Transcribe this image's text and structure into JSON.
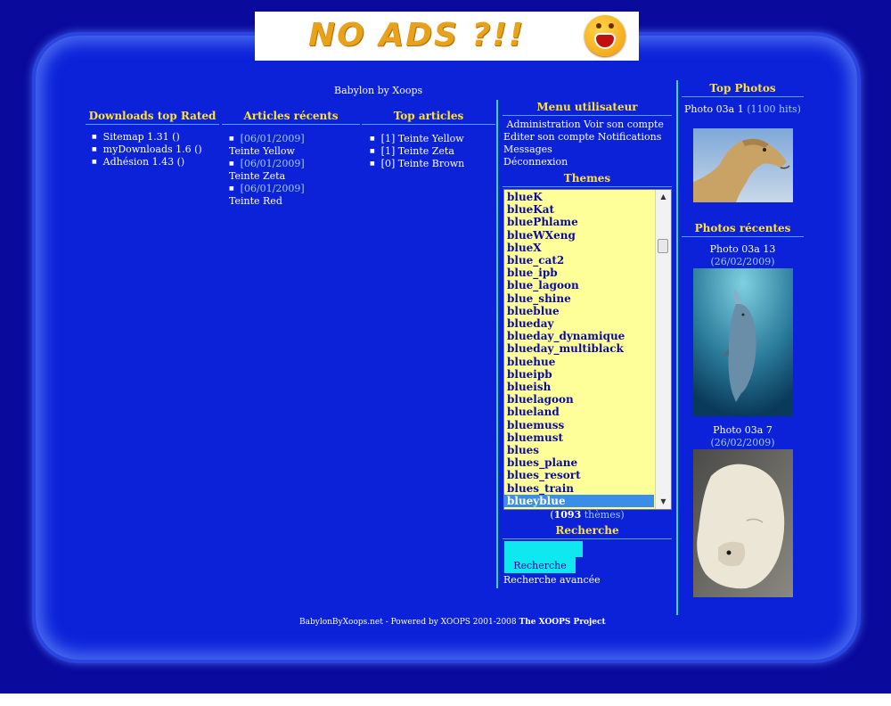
{
  "banner": {
    "text": "NO ADS ?!!"
  },
  "site_title": "Babylon by Xoops",
  "downloads": {
    "title": "Downloads top Rated",
    "items": [
      "Sitemap 1.31 ()",
      "myDownloads 1.6 ()",
      "Adhésion 1.43 ()"
    ]
  },
  "articles_recent": {
    "title": "Articles récents",
    "items": [
      {
        "date": "[06/01/2009]",
        "label": "Teinte Yellow"
      },
      {
        "date": "[06/01/2009]",
        "label": "Teinte Zeta"
      },
      {
        "date": "[06/01/2009]",
        "label": "Teinte Red"
      }
    ]
  },
  "top_articles": {
    "title": "Top articles",
    "items": [
      "[1] Teinte Yellow",
      "[1] Teinte Zeta",
      "[0] Teinte Brown"
    ]
  },
  "user_menu": {
    "title": "Menu utilisateur",
    "items": [
      "Administration",
      "Voir son compte",
      "Editer son compte",
      "Notifications",
      "Messages",
      "Déconnexion"
    ]
  },
  "themes": {
    "title": "Themes",
    "items": [
      "blueK",
      "blueKat",
      "bluePhlame",
      "blueWXeng",
      "blueX",
      "blue_cat2",
      "blue_ipb",
      "blue_lagoon",
      "blue_shine",
      "blueblue",
      "blueday",
      "blueday_dynamique",
      "blueday_multiblack",
      "bluehue",
      "blueipb",
      "blueish",
      "bluelagoon",
      "blueland",
      "bluemuss",
      "bluemust",
      "blues",
      "blues_plane",
      "blues_resort",
      "blues_train",
      "blueyblue"
    ],
    "selected": "blueyblue",
    "count": "1093",
    "count_suffix": "thèmes)",
    "count_prefix": "("
  },
  "search": {
    "title": "Recherche",
    "input_value": "",
    "button_label": "Recherche",
    "advanced_link": "Recherche avancée"
  },
  "top_photos": {
    "title": "Top Photos",
    "caption_a": "Photo 03a 1",
    "caption_b": "(1100 hits)"
  },
  "recent_photos": {
    "title": "Photos récentes",
    "items": [
      {
        "name": "Photo 03a 13",
        "date": "(26/02/2009)"
      },
      {
        "name": "Photo 03a 7",
        "date": "(26/02/2009)"
      }
    ]
  },
  "footer": {
    "text": "BabylonByXoops.net - Powered by XOOPS 2001-2008",
    "link": "The XOOPS Project"
  },
  "colors": {
    "background": "#0a0a9c",
    "panel": "#0b22d8",
    "accent": "#ffe13a",
    "rule": "#3ed6b8",
    "select_bg": "#ffff99"
  }
}
